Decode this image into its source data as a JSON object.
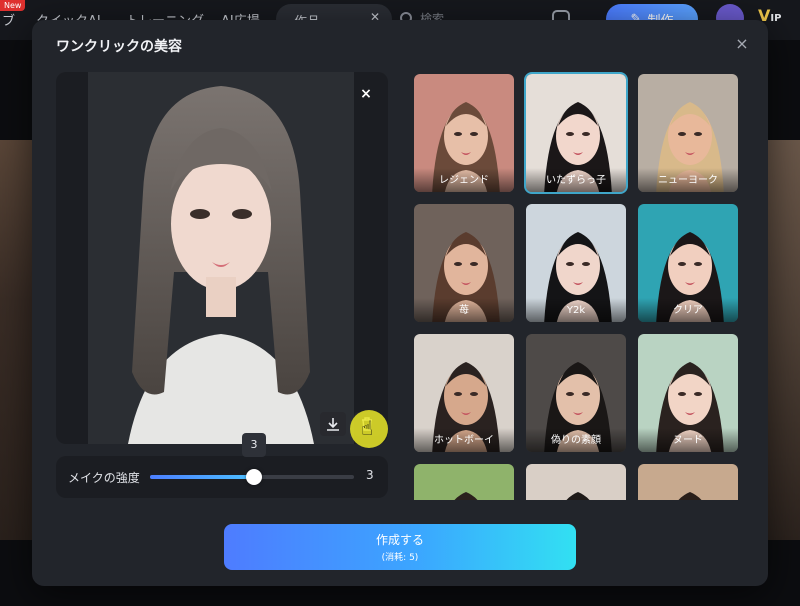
{
  "app_header": {
    "new_badge": "New",
    "tab_partial": "ブ",
    "tab_quick_ai": "クイックAI",
    "tab_training": "トレーニング",
    "tab_ai_ad": "AI広場",
    "dropdown_value": "作品",
    "search_placeholder": "検索",
    "create_button": "制作",
    "vip_label": "V",
    "vip_suffix": "IP"
  },
  "modal": {
    "title": "ワンクリックの美容",
    "close_icon": "×"
  },
  "preview": {
    "close_icon": "×",
    "download_icon": "download-icon",
    "delete_icon": "trash-icon"
  },
  "slider": {
    "label": "メイクの強度",
    "value": "3",
    "tooltip": "3",
    "min": 0,
    "max": 5,
    "current": 3
  },
  "styles": [
    {
      "label": "レジェンド",
      "selected": false,
      "bg": "#c98a7f",
      "skin": "#e7bfa8",
      "hair": "#6b4a3a"
    },
    {
      "label": "いたずらっ子",
      "selected": true,
      "bg": "#e5ded8",
      "skin": "#f2d7cc",
      "hair": "#1b1718"
    },
    {
      "label": "ニューヨーク",
      "selected": false,
      "bg": "#b8aea3",
      "skin": "#e8b89a",
      "hair": "#d8b98a"
    },
    {
      "label": "苺",
      "selected": false,
      "bg": "#6f625b",
      "skin": "#e1b59c",
      "hair": "#5a3c2e"
    },
    {
      "label": "Y2k",
      "selected": false,
      "bg": "#cdd6dd",
      "skin": "#f0d6cb",
      "hair": "#141416"
    },
    {
      "label": "クリア",
      "selected": false,
      "bg": "#2fa4b3",
      "skin": "#f1cfbf",
      "hair": "#1b1718"
    },
    {
      "label": "ホットボーイ",
      "selected": false,
      "bg": "#d9d2cb",
      "skin": "#d6a88c",
      "hair": "#2a2220"
    },
    {
      "label": "偽りの素顔",
      "selected": false,
      "bg": "#4e4a48",
      "skin": "#e3c0aa",
      "hair": "#1a1716"
    },
    {
      "label": "ヌード",
      "selected": false,
      "bg": "#b9d3c2",
      "skin": "#f2d5c6",
      "hair": "#2a221f"
    },
    {
      "label": "",
      "selected": false,
      "bg": "#8fb36b",
      "skin": "#e6c3ad",
      "hair": "#2b211d"
    },
    {
      "label": "",
      "selected": false,
      "bg": "#d9cfc6",
      "skin": "#ead0c0",
      "hair": "#1f1a18"
    },
    {
      "label": "",
      "selected": false,
      "bg": "#c7a98e",
      "skin": "#e9c9b5",
      "hair": "#2a1f1a"
    }
  ],
  "create": {
    "label": "作成する",
    "cost": "(消耗: 5)"
  }
}
